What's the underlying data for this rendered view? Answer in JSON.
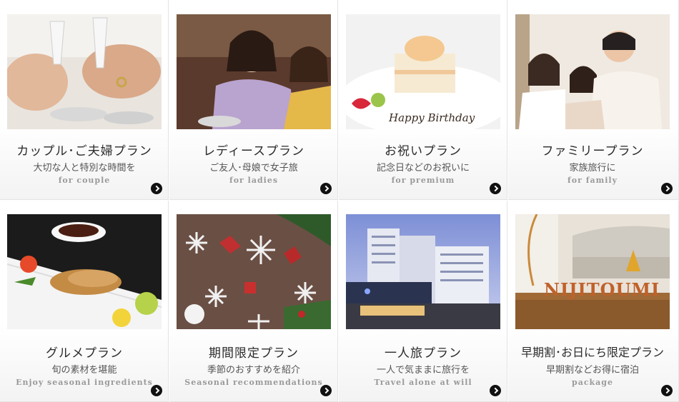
{
  "plans": [
    {
      "title": "カップル･ご夫婦プラン",
      "subtitle": "大切な人と特別な時間を",
      "en": "for couple",
      "photo_icon": "champagne-toast-photo"
    },
    {
      "title": "レディースプラン",
      "subtitle": "ご友人･母娘で女子旅",
      "en": "for ladies",
      "photo_icon": "ladies-yukata-photo"
    },
    {
      "title": "お祝いプラン",
      "subtitle": "記念日などのお祝いに",
      "en": "for premium",
      "photo_icon": "birthday-cake-photo"
    },
    {
      "title": "ファミリープラン",
      "subtitle": "家族旅行に",
      "en": "for family",
      "photo_icon": "family-photo"
    },
    {
      "title": "グルメプラン",
      "subtitle": "旬の素材を堪能",
      "en": "Enjoy seasonal ingredients",
      "photo_icon": "gourmet-dish-photo"
    },
    {
      "title": "期間限定プラン",
      "subtitle": "季節のおすすめを紹介",
      "en": "Seasonal recommendations",
      "photo_icon": "christmas-decor-photo"
    },
    {
      "title": "一人旅プラン",
      "subtitle": "一人で気ままに旅行を",
      "en": "Travel alone at will",
      "photo_icon": "hotel-building-photo"
    },
    {
      "title": "早期割･お日にち限定プラン",
      "subtitle": "早期割などお得に宿泊",
      "en": "package",
      "photo_icon": "lobby-letters-photo"
    }
  ],
  "photo_text": {
    "cake_message": "Happy Birthday",
    "lobby_sign": "NIJITOUMI"
  },
  "colors": {
    "arrow": "#111111",
    "title": "#2b2b2b",
    "subtitle": "#555555",
    "english": "#9a9a9a"
  }
}
